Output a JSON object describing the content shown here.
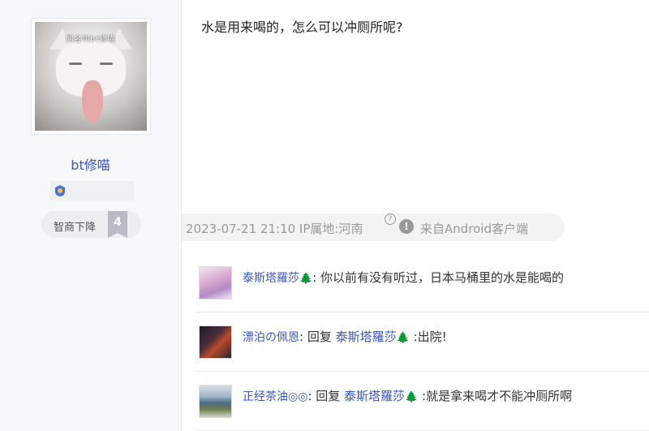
{
  "author": {
    "avatar_caption": "网名叫bt修喵",
    "username": "bt修喵",
    "level_name": "智商下降",
    "level_number": "4"
  },
  "post": {
    "text": "水是用来喝的，怎么可以冲厕所呢?",
    "date": "2023-07-21 21:10 IP属地:河南",
    "help_icon": "?",
    "warn_icon": "!",
    "source": "来自Android客户端"
  },
  "comments": [
    {
      "user": "泰斯塔羅莎",
      "user_suffix_icon": "🌲",
      "separator": ":",
      "reply_prefix": "",
      "reply_to": "",
      "reply_to_suffix_icon": "",
      "text": " 你以前有没有听过，日本马桶里的水是能喝的"
    },
    {
      "user": "漂泊の佩恩",
      "user_suffix_icon": "",
      "separator": ":",
      "reply_prefix": " 回复 ",
      "reply_to": "泰斯塔羅莎",
      "reply_to_suffix_icon": "🌲",
      "text": " :出院!"
    },
    {
      "user": "正经茶油◎◎",
      "user_suffix_icon": "",
      "separator": ":",
      "reply_prefix": " 回复 ",
      "reply_to": "泰斯塔羅莎",
      "reply_to_suffix_icon": "🌲",
      "text": " :就是拿来喝才不能冲厕所啊"
    }
  ],
  "colors": {
    "link": "#3b55c4",
    "meta": "#999999",
    "sidebar_bg": "#f6f8fb"
  }
}
